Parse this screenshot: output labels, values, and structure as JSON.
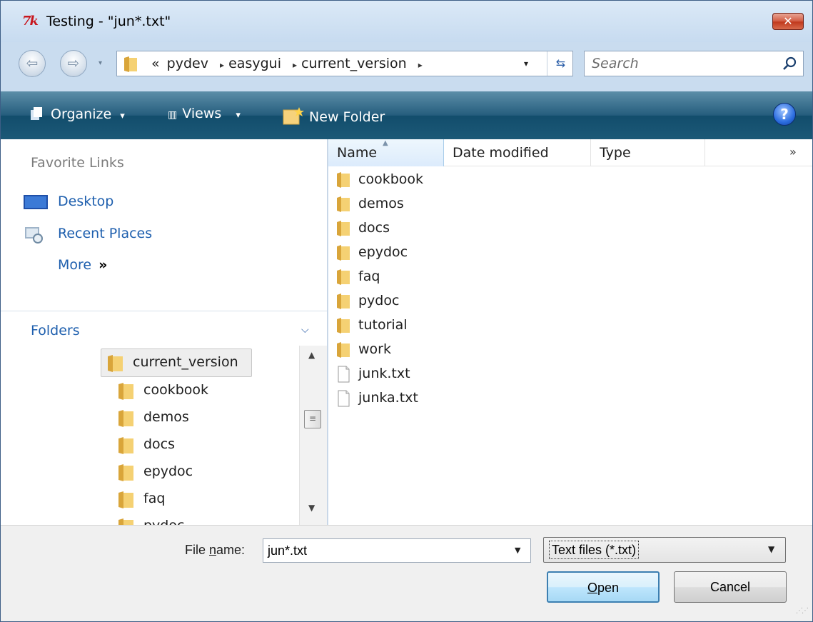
{
  "window": {
    "title": "Testing - \"jun*.txt\"",
    "logo_text": "7k",
    "close_label": "✕"
  },
  "address_bar": {
    "overflow_chevron": "«",
    "crumbs": [
      "pydev",
      "easygui",
      "current_version"
    ],
    "separator": "▸",
    "dropdown_glyph": "▾",
    "refresh_glyph": "⇆"
  },
  "search": {
    "placeholder": "Search"
  },
  "toolbar": {
    "organize_label": "Organize",
    "views_label": "Views",
    "new_folder_label": "New Folder",
    "dropdown_glyph": "▾",
    "help_label": "?"
  },
  "favorites": {
    "title": "Favorite Links",
    "items": [
      {
        "label": "Desktop",
        "icon": "desktop-icon"
      },
      {
        "label": "Recent Places",
        "icon": "recent-places-icon"
      }
    ],
    "more_label": "More",
    "more_glyph": "»"
  },
  "folders": {
    "title": "Folders",
    "chevron": "⌄",
    "tree": [
      {
        "label": "current_version",
        "selected": true,
        "indent": 1
      },
      {
        "label": "cookbook",
        "selected": false,
        "indent": 2
      },
      {
        "label": "demos",
        "selected": false,
        "indent": 2
      },
      {
        "label": "docs",
        "selected": false,
        "indent": 2
      },
      {
        "label": "epydoc",
        "selected": false,
        "indent": 2
      },
      {
        "label": "faq",
        "selected": false,
        "indent": 2
      },
      {
        "label": "pydoc",
        "selected": false,
        "indent": 2
      }
    ]
  },
  "file_list": {
    "columns": [
      "Name",
      "Date modified",
      "Type"
    ],
    "more_columns_glyph": "»",
    "sort_glyph": "▲",
    "items": [
      {
        "name": "cookbook",
        "kind": "folder"
      },
      {
        "name": "demos",
        "kind": "folder"
      },
      {
        "name": "docs",
        "kind": "folder"
      },
      {
        "name": "epydoc",
        "kind": "folder"
      },
      {
        "name": "faq",
        "kind": "folder"
      },
      {
        "name": "pydoc",
        "kind": "folder"
      },
      {
        "name": "tutorial",
        "kind": "folder"
      },
      {
        "name": "work",
        "kind": "folder"
      },
      {
        "name": "junk.txt",
        "kind": "file"
      },
      {
        "name": "junka.txt",
        "kind": "file"
      }
    ]
  },
  "bottom": {
    "file_name_label_pre": "File ",
    "file_name_label_u": "n",
    "file_name_label_post": "ame:",
    "file_name_value": "jun*.txt",
    "file_type_value": "Text files (*.txt)",
    "open_label_u": "O",
    "open_label_rest": "pen",
    "cancel_label": "Cancel",
    "dropdown_glyph": "▼"
  },
  "colors": {
    "toolbar_bg": "#1c5977",
    "link_blue": "#1e5fae",
    "close_red": "#c13a1e",
    "folder_yellow": "#f2c65a"
  }
}
